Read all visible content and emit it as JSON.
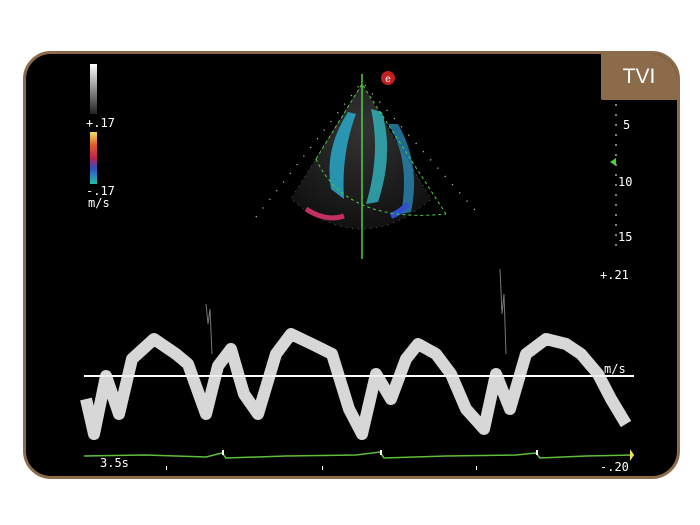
{
  "mode_label": "TVI",
  "color_scale": {
    "top": "+.17",
    "bottom": "-.17",
    "unit": "m/s"
  },
  "depth_marks": [
    "5",
    "10",
    "15"
  ],
  "velocity_scale": {
    "top": "+.21",
    "bottom": "-.20",
    "unit": "m/s"
  },
  "sweep_time": "3.5s",
  "logo_letter": "e",
  "colors": {
    "frame": "#8b6b4a",
    "ecg": "#5fbf3c",
    "background": "#000000"
  }
}
